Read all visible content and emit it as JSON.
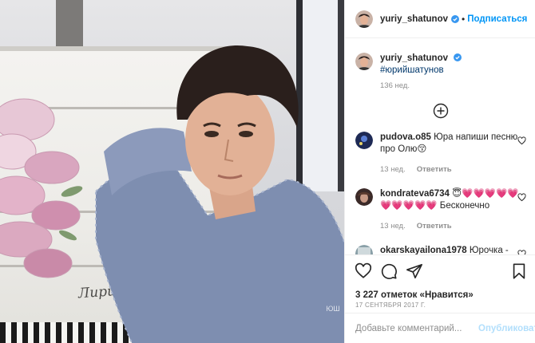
{
  "photo": {
    "piano_brand": "Лирика",
    "watermark": "ЮШ"
  },
  "header": {
    "username": "yuriy_shatunov",
    "separator": "•",
    "follow_label": "Подписаться"
  },
  "caption": {
    "username": "yuriy_shatunov",
    "hashtag": "#юрийшатунов",
    "time": "136 нед."
  },
  "comments": [
    {
      "username": "pudova.o85",
      "text": "Юра напиши песню про Олю😚",
      "time": "13 нед.",
      "reply_label": "Ответить"
    },
    {
      "username": "kondrateva6734",
      "text": "😇💗💗💗💗💗💗💗💗💗💗 Бесконечно",
      "time": "13 нед.",
      "reply_label": "Ответить"
    },
    {
      "username": "okarskayailona1978",
      "text": "Юрочка - самый лучший!!!!!❤️❤️❤️❤️❤️❤️",
      "time": "",
      "reply_label": ""
    }
  ],
  "actions": {
    "likes": "3 227 отметок «Нравится»",
    "date": "17 СЕНТЯБРЯ 2017 Г."
  },
  "add_comment": {
    "placeholder": "Добавьте комментарий...",
    "post_label": "Опубликовать"
  },
  "colors": {
    "accent": "#0095f6",
    "hashtag": "#00376b",
    "muted": "#8e8e8e",
    "post_disabled": "#b2dffc"
  }
}
